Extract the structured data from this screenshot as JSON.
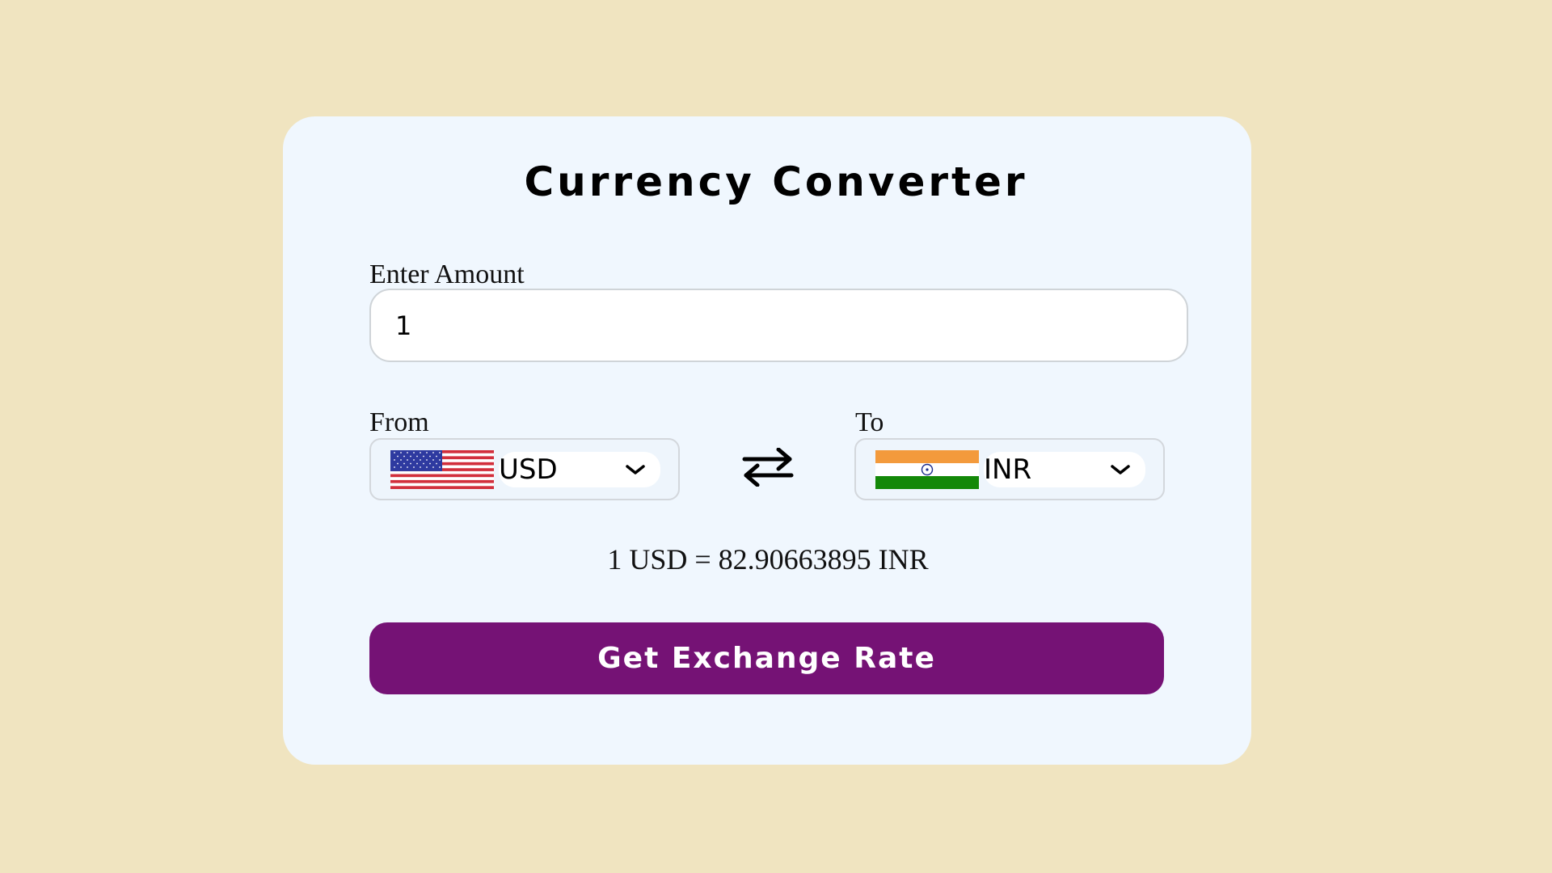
{
  "app": {
    "title": "Currency Converter"
  },
  "amount": {
    "label": "Enter Amount",
    "value": "1"
  },
  "from": {
    "label": "From",
    "currency": "USD",
    "flag_icon": "us-flag-icon"
  },
  "to": {
    "label": "To",
    "currency": "INR",
    "flag_icon": "india-flag-icon"
  },
  "swap": {
    "icon": "swap-arrows-icon"
  },
  "result": {
    "text": "1 USD = 82.90663895 INR"
  },
  "button": {
    "label": "Get Exchange Rate"
  },
  "colors": {
    "background": "#f0e4c0",
    "card": "#f0f7fe",
    "button": "#751275",
    "button_text": "#ffffff"
  }
}
